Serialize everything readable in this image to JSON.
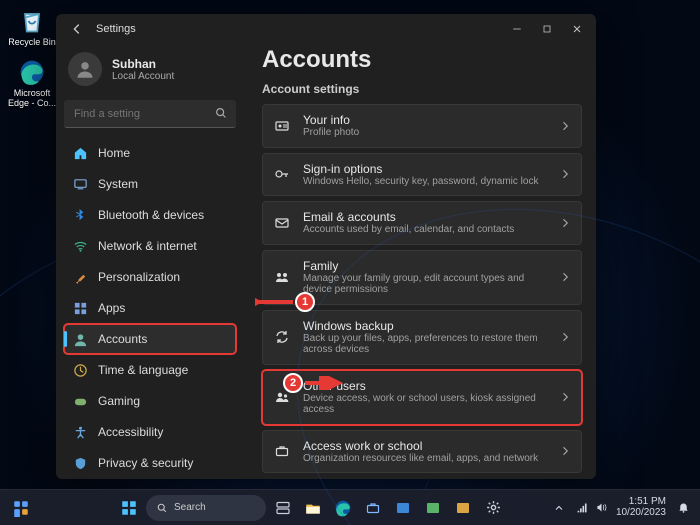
{
  "desktop": {
    "icons": [
      {
        "name": "recycle-bin",
        "label": "Recycle Bin"
      },
      {
        "name": "microsoft-edge",
        "label": "Microsoft Edge - Co..."
      }
    ]
  },
  "window": {
    "title": "Settings",
    "profile": {
      "name": "Subhan",
      "sub": "Local Account"
    },
    "search_placeholder": "Find a setting",
    "sidebar": [
      {
        "id": "home",
        "label": "Home",
        "icon": "home-icon"
      },
      {
        "id": "system",
        "label": "System",
        "icon": "system-icon"
      },
      {
        "id": "bluetooth",
        "label": "Bluetooth & devices",
        "icon": "bluetooth-icon"
      },
      {
        "id": "network",
        "label": "Network & internet",
        "icon": "wifi-icon"
      },
      {
        "id": "personalization",
        "label": "Personalization",
        "icon": "brush-icon"
      },
      {
        "id": "apps",
        "label": "Apps",
        "icon": "apps-icon"
      },
      {
        "id": "accounts",
        "label": "Accounts",
        "icon": "person-icon",
        "active": true,
        "highlight": true
      },
      {
        "id": "time",
        "label": "Time & language",
        "icon": "clock-icon"
      },
      {
        "id": "gaming",
        "label": "Gaming",
        "icon": "gaming-icon"
      },
      {
        "id": "accessibility",
        "label": "Accessibility",
        "icon": "accessibility-icon"
      },
      {
        "id": "privacy",
        "label": "Privacy & security",
        "icon": "shield-icon"
      }
    ],
    "main": {
      "heading": "Accounts",
      "section_label": "Account settings",
      "cards": [
        {
          "id": "your-info",
          "title": "Your info",
          "sub": "Profile photo",
          "icon": "id-icon"
        },
        {
          "id": "signin",
          "title": "Sign-in options",
          "sub": "Windows Hello, security key, password, dynamic lock",
          "icon": "key-icon"
        },
        {
          "id": "email",
          "title": "Email & accounts",
          "sub": "Accounts used by email, calendar, and contacts",
          "icon": "mail-icon"
        },
        {
          "id": "family",
          "title": "Family",
          "sub": "Manage your family group, edit account types and device permissions",
          "icon": "family-icon"
        },
        {
          "id": "backup",
          "title": "Windows backup",
          "sub": "Back up your files, apps, preferences to restore them across devices",
          "icon": "sync-icon"
        },
        {
          "id": "other-users",
          "title": "Other users",
          "sub": "Device access, work or school users, kiosk assigned access",
          "icon": "other-users-icon",
          "highlight": true
        },
        {
          "id": "work-school",
          "title": "Access work or school",
          "sub": "Organization resources like email, apps, and network",
          "icon": "briefcase-icon"
        }
      ]
    }
  },
  "callouts": {
    "one": "1",
    "two": "2"
  },
  "taskbar": {
    "search_label": "Search",
    "clock": {
      "time": "1:51 PM",
      "date": "10/20/2023"
    }
  }
}
